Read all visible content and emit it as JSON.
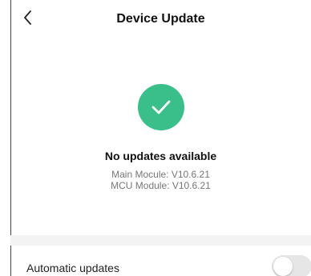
{
  "header": {
    "title": "Device Update",
    "back_icon": "chevron-left-icon"
  },
  "status": {
    "icon": "checkmark-icon",
    "icon_color": "#3bbf8a",
    "title": "No updates available",
    "main_module": "Main Mocule: V10.6.21",
    "mcu_module": "MCU Module: V10.6.21"
  },
  "settings": {
    "automatic_updates_label": "Automatic updates",
    "automatic_updates_enabled": false
  }
}
